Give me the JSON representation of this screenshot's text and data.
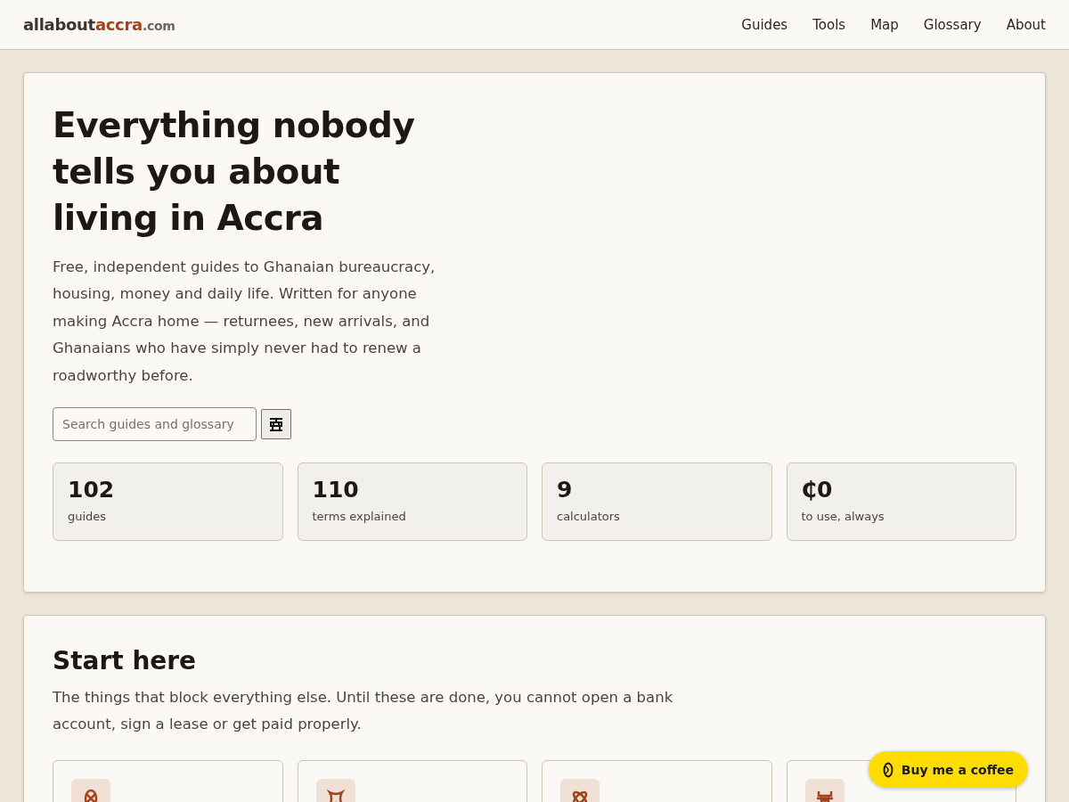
{
  "header": {
    "logo": {
      "main": "allabout",
      "highlight": "accra",
      "suffix": ".com"
    },
    "nav": [
      {
        "label": "Guides"
      },
      {
        "label": "Tools"
      },
      {
        "label": "Map"
      },
      {
        "label": "Glossary"
      },
      {
        "label": "About"
      }
    ]
  },
  "hero": {
    "title": "Everything nobody tells you about living in Accra",
    "intro": "Free, independent guides to Ghanaian bureaucracy, housing, money and daily life. Written for anyone making Accra home — returnees, new arrivals, and Ghanaians who have simply never had to renew a roadworthy before.",
    "search": {
      "placeholder": "Search guides and glossary"
    },
    "stats": [
      {
        "value": "102",
        "label": "guides"
      },
      {
        "value": "110",
        "label": "terms explained"
      },
      {
        "value": "9",
        "label": "calculators"
      },
      {
        "value": "₵0",
        "label": "to use, always"
      }
    ]
  },
  "start_here": {
    "title": "Start here",
    "intro": "The things that block everything else. Until these are done, you cannot open a bank account, sign a lease or get paid properly.",
    "cards": [
      {
        "kind": "knot"
      },
      {
        "kind": "frame"
      },
      {
        "kind": "cross"
      },
      {
        "kind": "crab"
      }
    ]
  },
  "coffee_button": {
    "label": "Buy me a coffee"
  }
}
